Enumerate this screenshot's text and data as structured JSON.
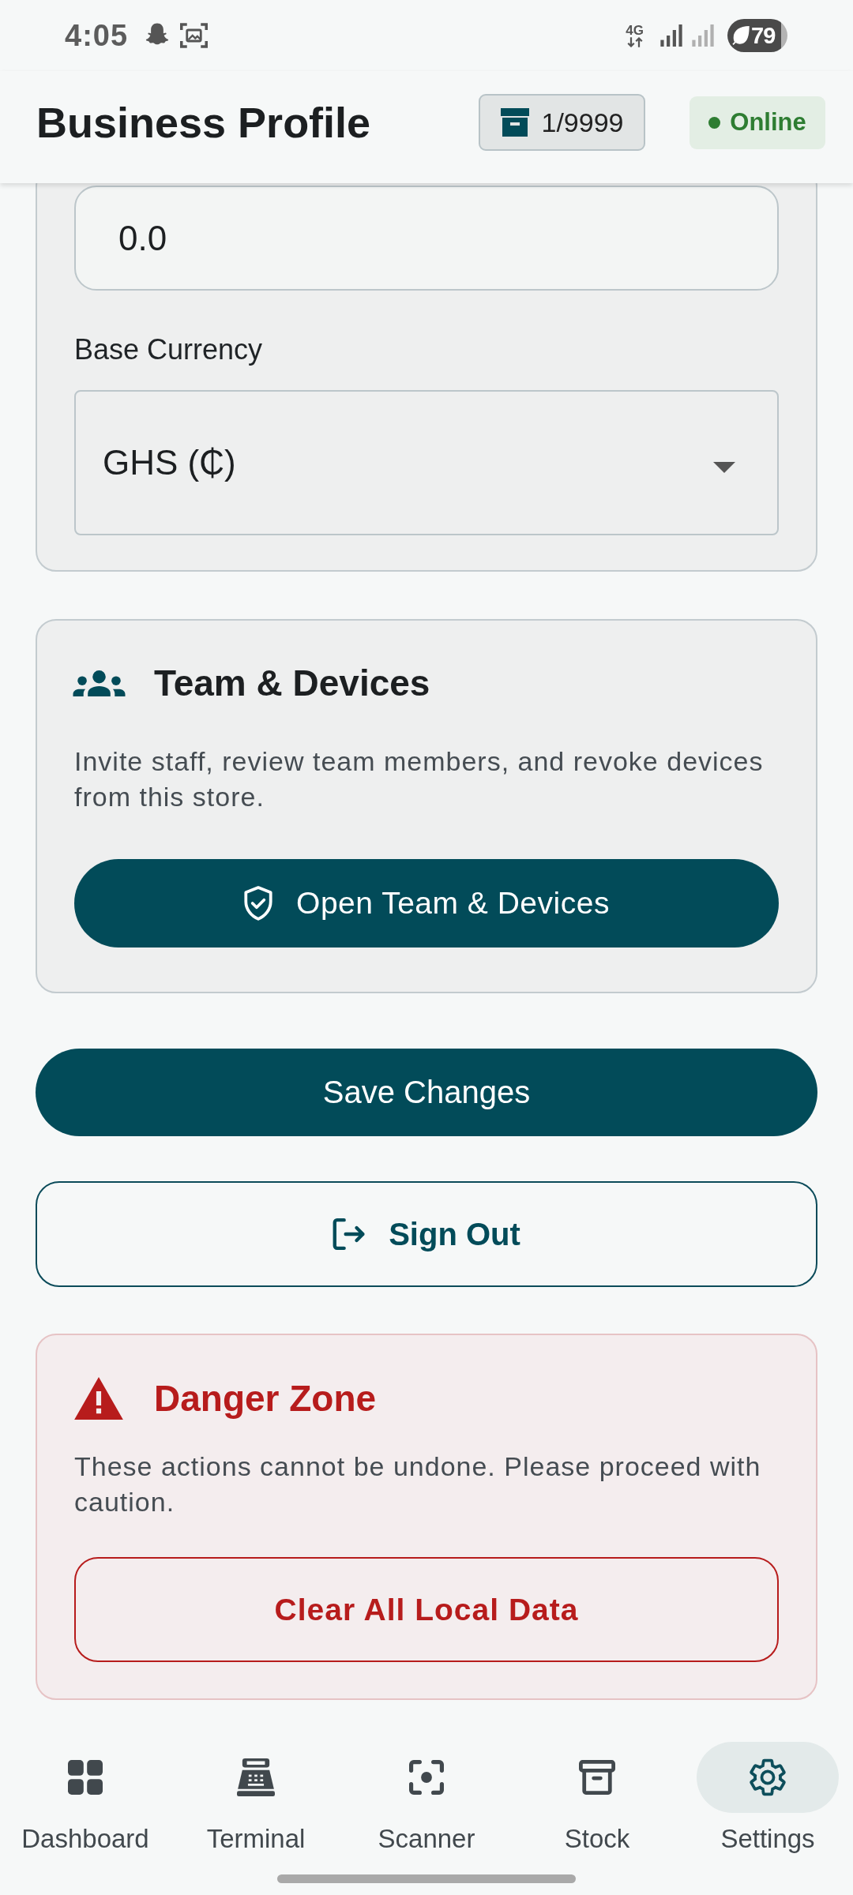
{
  "status_bar": {
    "time": "4:05",
    "network_type": "4G",
    "battery": "79"
  },
  "header": {
    "title": "Business Profile",
    "counter": "1/9999",
    "status": {
      "label": "Online",
      "online": true
    }
  },
  "settings_card": {
    "input_field": {
      "value": "0.0"
    },
    "currency": {
      "label": "Base Currency",
      "value": "GHS (₵)"
    }
  },
  "team_card": {
    "title": "Team & Devices",
    "description": "Invite staff, review team members, and revoke devices from this store.",
    "button": "Open Team & Devices"
  },
  "actions": {
    "save_button": "Save Changes",
    "sign_out_button": "Sign Out"
  },
  "danger_zone": {
    "title": "Danger Zone",
    "description": "These actions cannot be undone. Please proceed with caution.",
    "button": "Clear All Local Data"
  },
  "bottom_nav": [
    {
      "label": "Dashboard",
      "selected": false
    },
    {
      "label": "Terminal",
      "selected": false
    },
    {
      "label": "Scanner",
      "selected": false
    },
    {
      "label": "Stock",
      "selected": false
    },
    {
      "label": "Settings",
      "selected": true
    }
  ]
}
